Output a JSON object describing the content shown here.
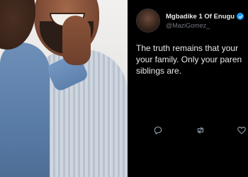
{
  "tweet": {
    "display_name": "Mgbadike 1 Of Enugu",
    "handle": "@MaziGomez_",
    "text_lines": [
      "The truth remains that your",
      "your family. Only your paren",
      "siblings are."
    ],
    "verified_color": "#1d9bf0"
  },
  "icons": {
    "avatar": "avatar",
    "verified": "verified-badge-icon",
    "reply": "reply-icon",
    "retweet": "retweet-icon",
    "like": "heart-icon"
  }
}
